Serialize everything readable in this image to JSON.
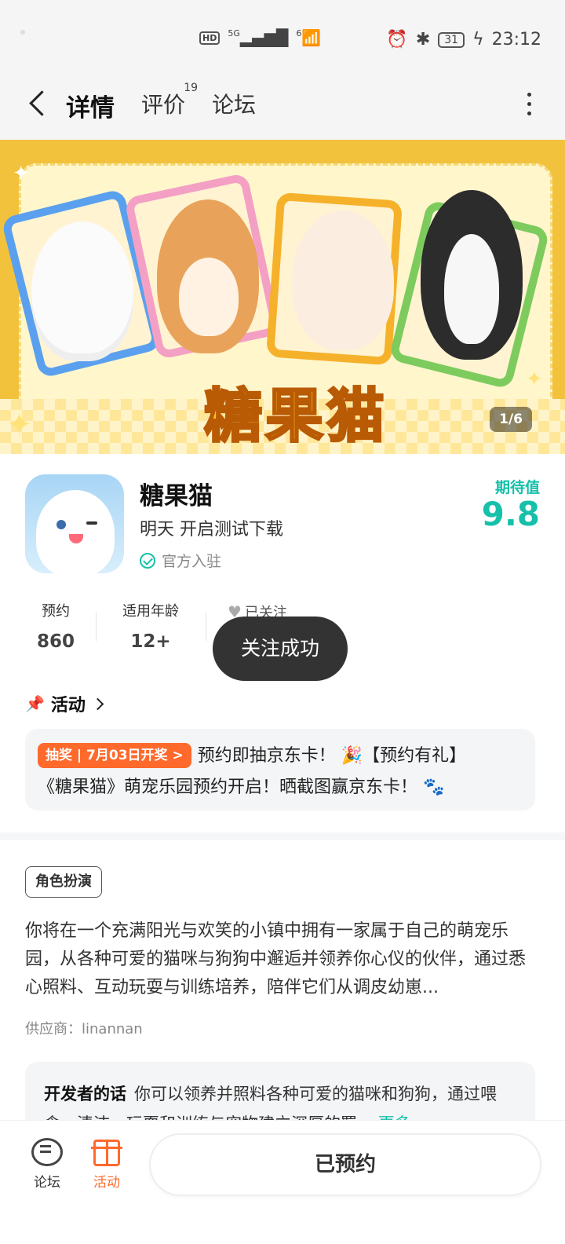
{
  "status_bar": {
    "network": "HD",
    "signal": "5G",
    "wifi": "6",
    "battery": "31",
    "time": "23:12"
  },
  "nav": {
    "tabs": [
      {
        "label": "详情",
        "active": true
      },
      {
        "label": "评价",
        "badge": "19"
      },
      {
        "label": "论坛"
      }
    ]
  },
  "banner": {
    "logo_text": "糖果猫",
    "pager": "1/6"
  },
  "app": {
    "name": "糖果猫",
    "subtitle": "明天 开启测试下载",
    "official_label": "官方入驻",
    "expect_label": "期待值",
    "expect_value": "9.8"
  },
  "stats": {
    "reservations_label": "预约",
    "reservations_value": "860",
    "age_label": "适用年龄",
    "age_value": "12+",
    "followed_label": "已关注"
  },
  "toast": "关注成功",
  "activity": {
    "heading": "活动",
    "tag": "抽奖 | 7月03日开奖 >",
    "text_line1": "预约即抽京东卡！ 🎉【预约有礼】",
    "text_line2": "《糖果猫》萌宠乐园预约开启！晒截图赢京东卡！ 🐾"
  },
  "details": {
    "genre": "角色扮演",
    "description": "你将在一个充满阳光与欢笑的小镇中拥有一家属于自己的萌宠乐园，从各种可爱的猫咪与狗狗中邂逅并领养你心仪的伙伴，通过悉心照料、互动玩耍与训练培养，陪伴它们从调皮幼崽...",
    "vendor": "供应商：linannan"
  },
  "developer": {
    "title": "开发者的话",
    "text": "你可以领养并照料各种可爱的猫咪和狗狗，通过喂食、清洁、玩耍和训练与宠物建立深厚的羁",
    "more": "更多"
  },
  "bottom_bar": {
    "forum_label": "论坛",
    "activity_label": "活动",
    "reserve_button": "已预约"
  },
  "colors": {
    "accent": "#16c0aa",
    "orange": "#ff6a2c"
  }
}
